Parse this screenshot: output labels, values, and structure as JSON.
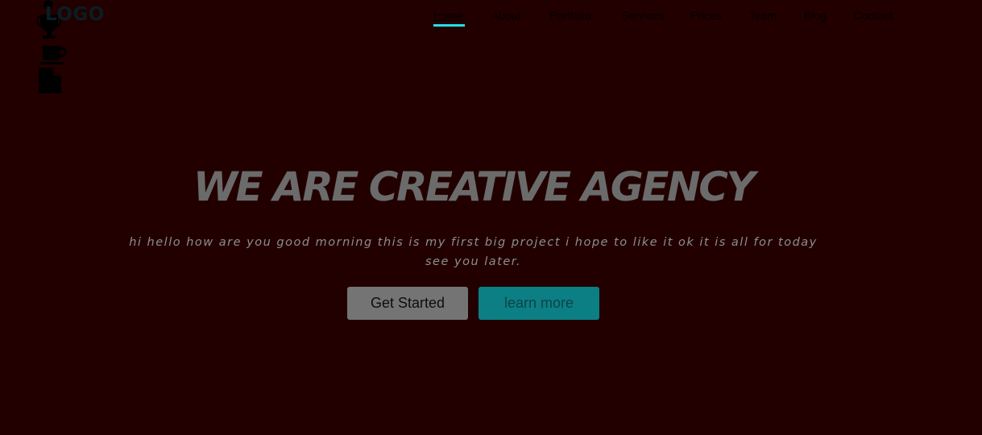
{
  "header": {
    "logo": "LOGO"
  },
  "nav": {
    "items": [
      {
        "label": "Home",
        "active": true
      },
      {
        "label": "About"
      },
      {
        "label": "Portfolio"
      },
      {
        "label": "Services"
      },
      {
        "label": "Prices"
      },
      {
        "label": "Team"
      },
      {
        "label": "Blog"
      },
      {
        "label": "Contact"
      }
    ]
  },
  "side_icons": [
    "trophy-icon",
    "coffee-cup-icon",
    "document-icon"
  ],
  "hero": {
    "title": "WE ARE CREATIVE AGENCY",
    "subtitle": "hi hello how are you good morning this is my first big project i hope to like it ok it is all for today see you later.",
    "primary_button": "Get Started",
    "secondary_button": "learn more"
  },
  "colors": {
    "background": "#220000",
    "accent": "#25e0e6",
    "secondary_button": "#0b7f84",
    "primary_button": "#747474"
  }
}
